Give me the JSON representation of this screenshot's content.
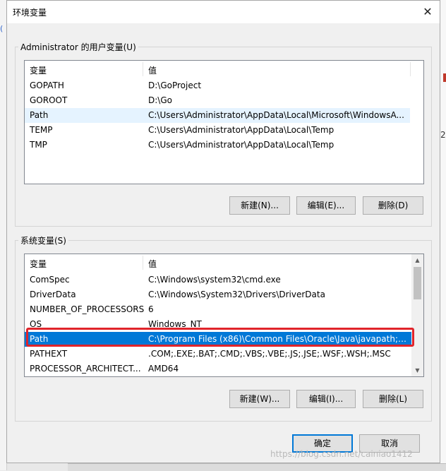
{
  "dialog": {
    "title": "环境变量",
    "close_glyph": "✕"
  },
  "user_vars": {
    "group_label": "Administrator 的用户变量(U)",
    "columns": {
      "name": "变量",
      "value": "值"
    },
    "rows": [
      {
        "name": "GOPATH",
        "value": "D:\\GoProject"
      },
      {
        "name": "GOROOT",
        "value": "D:\\Go"
      },
      {
        "name": "Path",
        "value": "C:\\Users\\Administrator\\AppData\\Local\\Microsoft\\WindowsA..."
      },
      {
        "name": "TEMP",
        "value": "C:\\Users\\Administrator\\AppData\\Local\\Temp"
      },
      {
        "name": "TMP",
        "value": "C:\\Users\\Administrator\\AppData\\Local\\Temp"
      }
    ],
    "buttons": {
      "new": "新建(N)...",
      "edit": "编辑(E)...",
      "delete": "删除(D)"
    }
  },
  "system_vars": {
    "group_label": "系统变量(S)",
    "columns": {
      "name": "变量",
      "value": "值"
    },
    "rows": [
      {
        "name": "ComSpec",
        "value": "C:\\Windows\\system32\\cmd.exe"
      },
      {
        "name": "DriverData",
        "value": "C:\\Windows\\System32\\Drivers\\DriverData"
      },
      {
        "name": "NUMBER_OF_PROCESSORS",
        "value": "6"
      },
      {
        "name": "OS",
        "value": "Windows_NT"
      },
      {
        "name": "Path",
        "value": "C:\\Program Files (x86)\\Common Files\\Oracle\\Java\\javapath;C:..."
      },
      {
        "name": "PATHEXT",
        "value": ".COM;.EXE;.BAT;.CMD;.VBS;.VBE;.JS;.JSE;.WSF;.WSH;.MSC"
      },
      {
        "name": "PROCESSOR_ARCHITECT...",
        "value": "AMD64"
      }
    ],
    "selected_row": "Path",
    "buttons": {
      "new": "新建(W)...",
      "edit": "编辑(I)...",
      "delete": "删除(L)"
    }
  },
  "footer": {
    "ok": "确定",
    "cancel": "取消"
  },
  "watermark": "https://blog.csdn.net/cainiao1412",
  "background": {
    "right_digit": "2"
  },
  "colors": {
    "selection": "#0078d7",
    "highlight_box": "#e0242b",
    "hover_row": "#e5f3ff"
  }
}
